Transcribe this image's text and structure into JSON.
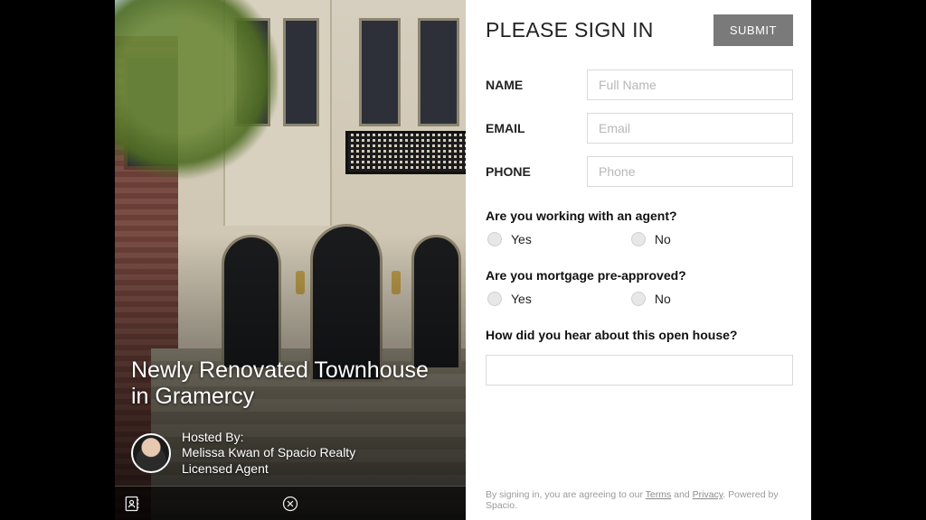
{
  "listing": {
    "title": "Newly Renovated Townhouse in Gramercy",
    "hosted_by_label": "Hosted By:",
    "host_line1": "Melissa Kwan of Spacio Realty",
    "host_line2": "Licensed Agent"
  },
  "form": {
    "heading": "PLEASE SIGN IN",
    "submit": "SUBMIT",
    "name_label": "NAME",
    "name_placeholder": "Full Name",
    "email_label": "EMAIL",
    "email_placeholder": "Email",
    "phone_label": "PHONE",
    "phone_placeholder": "Phone",
    "q_agent": "Are you working with an agent?",
    "q_mortgage": "Are you mortgage pre-approved?",
    "q_hear": "How did you hear about this open house?",
    "yes": "Yes",
    "no": "No"
  },
  "footer": {
    "pre": "By signing in, you are agreeing to our ",
    "terms": "Terms",
    "and": " and ",
    "privacy": "Privacy",
    "post": ". Powered by Spacio."
  }
}
